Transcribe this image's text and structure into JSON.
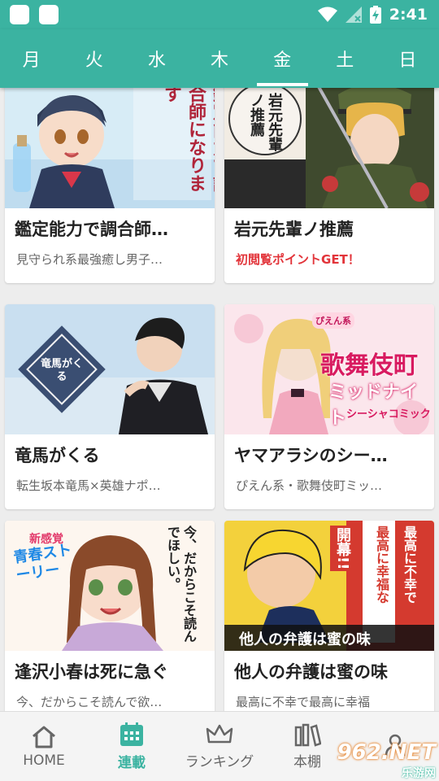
{
  "status_bar": {
    "time": "2:41"
  },
  "tabs": [
    {
      "label": "月"
    },
    {
      "label": "火"
    },
    {
      "label": "水"
    },
    {
      "label": "木"
    },
    {
      "label": "金"
    },
    {
      "label": "土"
    },
    {
      "label": "日"
    }
  ],
  "active_tab": "金",
  "cards": [
    {
      "title": "鑑定能力で調合師…",
      "subtitle": "見守られ系最強癒し男子…",
      "cover_text": "鑑定能力で調合師になります"
    },
    {
      "title": "岩元先輩ノ推薦",
      "subtitle": "初閲覧ポイントGET！",
      "cover_text": "岩元先輩ノ推薦"
    },
    {
      "title": "竜馬がくる",
      "subtitle": "転生坂本竜馬×英雄ナポ…",
      "cover_text": "竜馬がくる"
    },
    {
      "title": "ヤマアラシのシー…",
      "subtitle": "ぴえん系・歌舞伎町ミッ…",
      "cover_text_a": "歌舞伎町",
      "cover_text_b": "ミッドナイト",
      "cover_text_c": "シーシャコミック",
      "cover_text_d": "ぴえん系"
    },
    {
      "title": "逢沢小春は死に急ぐ",
      "subtitle": "今、だからこそ読んで欲…",
      "cover_text_a": "新感覚",
      "cover_text_b": "青春ストーリー",
      "cover_text_c": "今、だからこそ読んでほしい。"
    },
    {
      "title": "他人の弁護は蜜の味",
      "subtitle": "最高に不幸で最高に幸福",
      "cover_text_a": "開幕!!",
      "cover_text_b": "最高に不幸で",
      "cover_text_c": "最高に幸福な",
      "cover_text_d": "他人の弁護は蜜の味"
    }
  ],
  "bottom_nav": [
    {
      "label": "HOME",
      "icon": "home-icon"
    },
    {
      "label": "連載",
      "icon": "calendar-icon"
    },
    {
      "label": "ランキング",
      "icon": "crown-icon"
    },
    {
      "label": "本棚",
      "icon": "bookshelf-icon"
    },
    {
      "label": "",
      "icon": "person-icon"
    }
  ],
  "watermark": {
    "brand": "962.NET",
    "sub": "乐游网"
  },
  "colors": {
    "accent": "#3bb3a1",
    "promo": "#e2343a"
  }
}
